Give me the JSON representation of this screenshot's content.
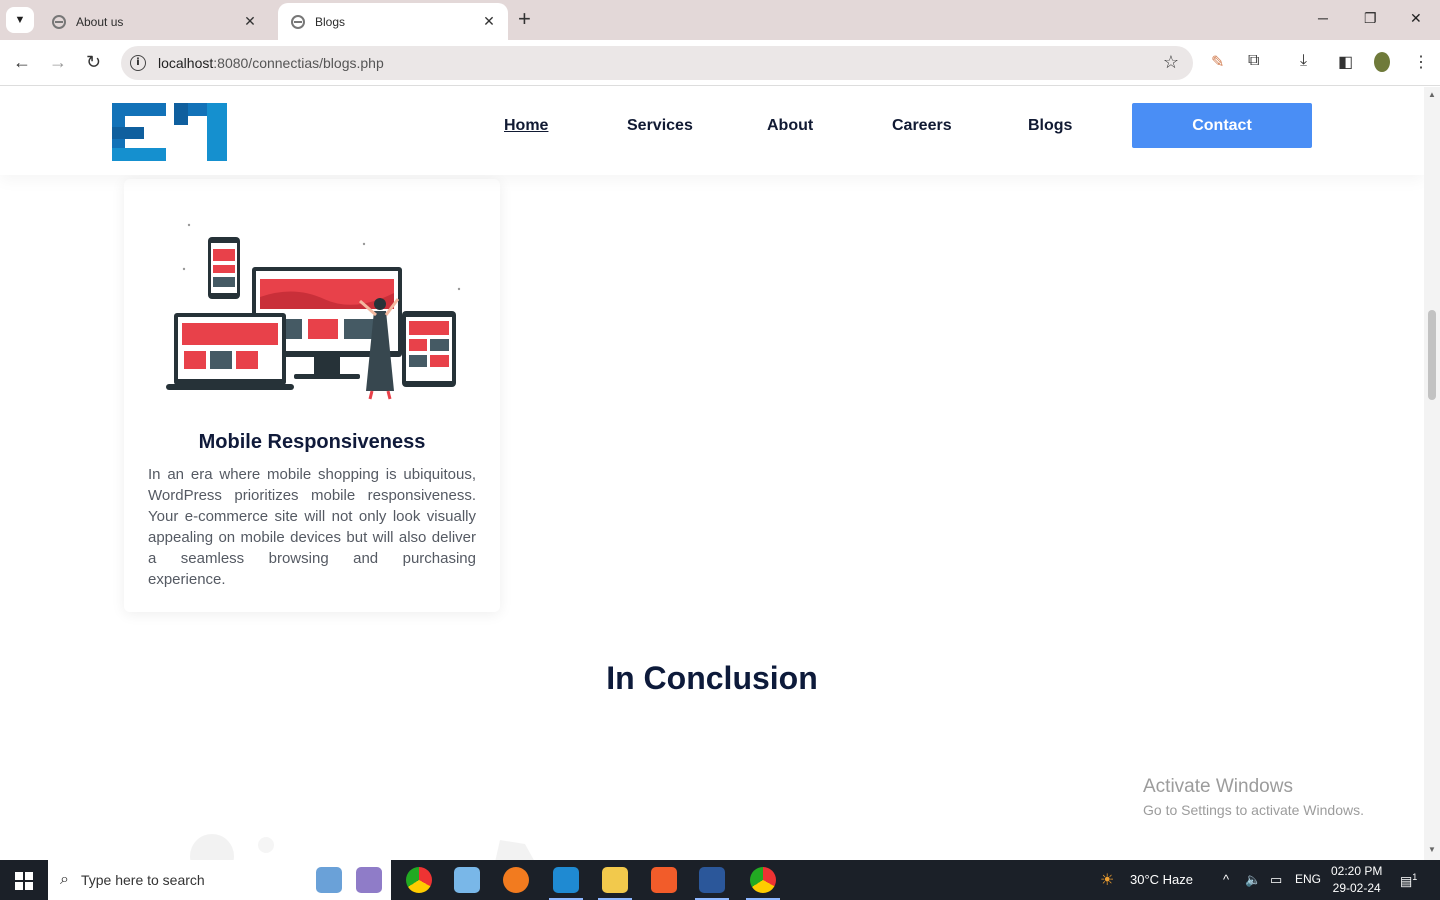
{
  "browser": {
    "tabs": [
      {
        "title": "About us"
      },
      {
        "title": "Blogs"
      }
    ],
    "url_host": "localhost",
    "url_path": ":8080/connectias/blogs.php"
  },
  "site": {
    "nav": [
      "Home",
      "Services",
      "About",
      "Careers",
      "Blogs"
    ],
    "contact_label": "Contact"
  },
  "card": {
    "title": "Mobile Responsiveness",
    "body": "In an era where mobile shopping is ubiquitous, WordPress prioritizes mobile responsiveness. Your e-commerce site will not only look visually appealing on mobile devices but will also deliver a seamless browsing and purchasing experience."
  },
  "section_heading": "In Conclusion",
  "watermark": {
    "title": "Activate Windows",
    "subtitle": "Go to Settings to activate Windows."
  },
  "taskbar": {
    "search_placeholder": "Type here to search",
    "weather": "30°C  Haze",
    "language": "ENG",
    "time": "02:20 PM",
    "date": "29-02-24",
    "notification_count": "1"
  },
  "colors": {
    "accent": "#4a8ef5",
    "logo_blue": "#1272b8",
    "navy": "#0d1a3a",
    "illustration_red": "#e8414a"
  }
}
